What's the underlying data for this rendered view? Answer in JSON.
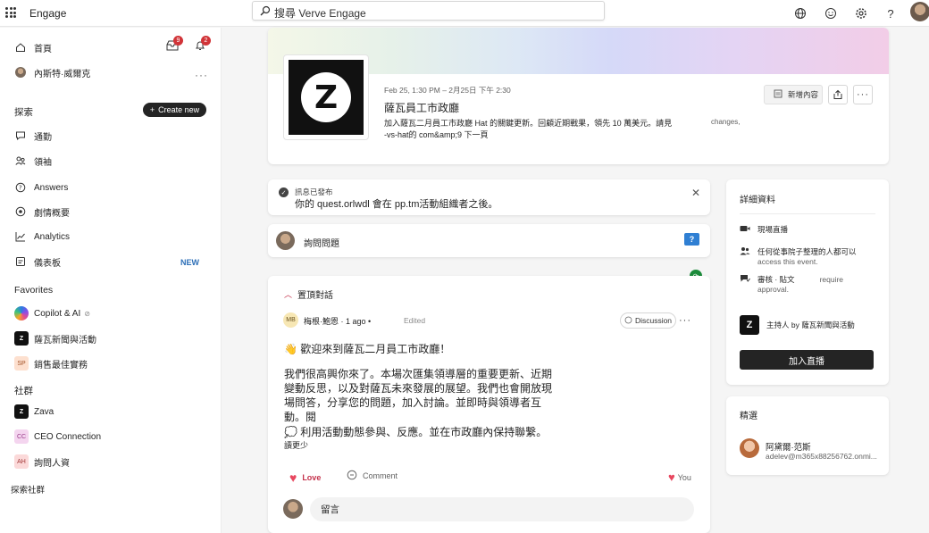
{
  "app": {
    "name": "Engage"
  },
  "search": {
    "text": "搜尋 Verve Engage"
  },
  "nav": {
    "home": "首頁",
    "home_badge": "9",
    "bell_badge": "2",
    "user": "內斯特·威爾克",
    "explore": "探索",
    "create": "Create new",
    "items": [
      {
        "label": "通勤"
      },
      {
        "label": "領袖"
      },
      {
        "label": "Answers"
      },
      {
        "label": "劇情概要"
      },
      {
        "label": "Analytics"
      },
      {
        "label": "儀表板",
        "tag": "NEW"
      }
    ],
    "favorites_title": "Favorites",
    "favorites": [
      {
        "label": "Copilot & AI",
        "badge": ""
      },
      {
        "label": "薩瓦新聞與活動",
        "badge": "Z"
      },
      {
        "label": "銷售最佳實務",
        "badge": "SP"
      }
    ],
    "communities_title": "社群",
    "communities": [
      {
        "label": "Zava",
        "badge": "Z"
      },
      {
        "label": "CEO Connection",
        "badge": "CC"
      },
      {
        "label": "詢問人資",
        "badge": "AH"
      }
    ],
    "discover": "探索社群"
  },
  "event": {
    "date": "Feb 25, 1:30 PM – 2月25日 下午 2:30",
    "title": "薩瓦員工市政廳",
    "desc_line1": "加入薩瓦二月員工市政廳",
    "desc_hat": "Hat",
    "desc_line1b": "的關鍵更新。回顧近期戰果，領先 10 萬美元。請見",
    "desc_line2": "-vs-hat的 com&amp;9 下一頁",
    "changes": "changes,",
    "add_button": "新增內容"
  },
  "notice": {
    "title": "訊息已發布",
    "text": "你的 quest.orlwdl 會在 pp.tm活動組織者之後。"
  },
  "ask": {
    "text": "詢問問題"
  },
  "post": {
    "pinned": "置頂對話",
    "initials": "MB",
    "author": "梅根·鮑恩 · 1 ago •",
    "edited": "Edited",
    "discussion": "Discussion",
    "welcome": "👋 歡迎來到薩瓦二月員工市政廳！",
    "body": "我們很高興你來了。本場次匯集領導層的重要更新、近期變動反思，以及對薩瓦未來發展的展望。我們也會開放現場問答，分享您的問題，加入討論。並即時與領導者互動。閱",
    "body2": "💭 利用活動動態參與、反應。並在市政廳內保持聯繫。",
    "see_more": "讀更少",
    "love": "Love",
    "comment": "Comment",
    "you": "You",
    "comment_placeholder": "留言"
  },
  "details": {
    "title": "詳細資料",
    "live": "現場直播",
    "access_line1": "任何從事院子整理的人都可以",
    "access_line2": "access this event.",
    "approval_line1": "審核 · 貼文",
    "approval_require": "require",
    "approval_line2": "approval.",
    "host": "主持人 by 薩瓦新聞與活動",
    "join": "加入直播"
  },
  "featured": {
    "title": "精選",
    "name": "阿黛爾·范斯",
    "email": "adelev@m365x88256762.onmi..."
  }
}
